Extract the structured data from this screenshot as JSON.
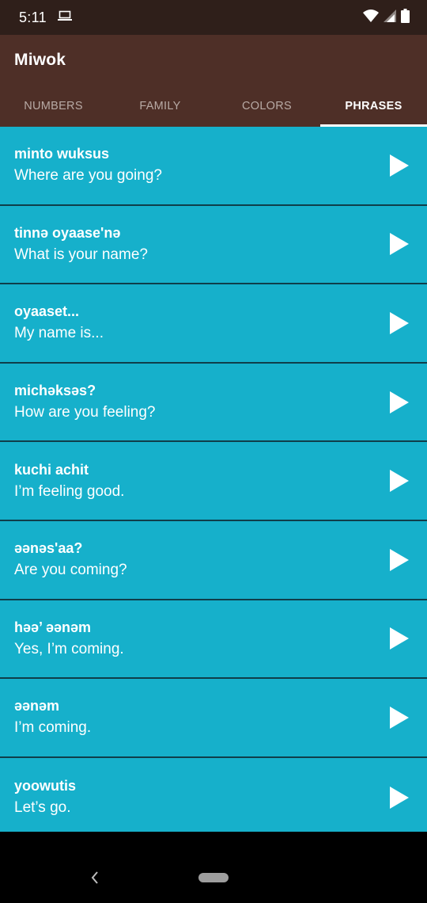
{
  "status_bar": {
    "time": "5:11"
  },
  "app_bar": {
    "title": "Miwok"
  },
  "tabs": [
    {
      "label": "NUMBERS",
      "active": false
    },
    {
      "label": "FAMILY",
      "active": false
    },
    {
      "label": "COLORS",
      "active": false
    },
    {
      "label": "PHRASES",
      "active": true
    }
  ],
  "phrases": [
    {
      "miwok": "minto wuksus",
      "english": "Where are you going?"
    },
    {
      "miwok": "tinnә oyaase'nә",
      "english": "What is your name?"
    },
    {
      "miwok": "oyaaset...",
      "english": "My name is..."
    },
    {
      "miwok": "michәksәs?",
      "english": "How are you feeling?"
    },
    {
      "miwok": "kuchi achit",
      "english": "I’m feeling good."
    },
    {
      "miwok": "әәnәs'aa?",
      "english": "Are you coming?"
    },
    {
      "miwok": "hәә’ әәnәm",
      "english": "Yes, I’m coming."
    },
    {
      "miwok": "әәnәm",
      "english": "I’m coming."
    },
    {
      "miwok": "yoowutis",
      "english": "Let’s go."
    }
  ],
  "colors": {
    "status_bar": "#2f1f1a",
    "primary": "#4e2f27",
    "list_background": "#16b0cb",
    "divider": "#0f3e4a"
  },
  "icons": {
    "play": "play-icon",
    "back": "back-icon",
    "wifi": "wifi-icon",
    "signal": "signal-icon",
    "battery": "battery-icon",
    "notification": "laptop-icon"
  }
}
